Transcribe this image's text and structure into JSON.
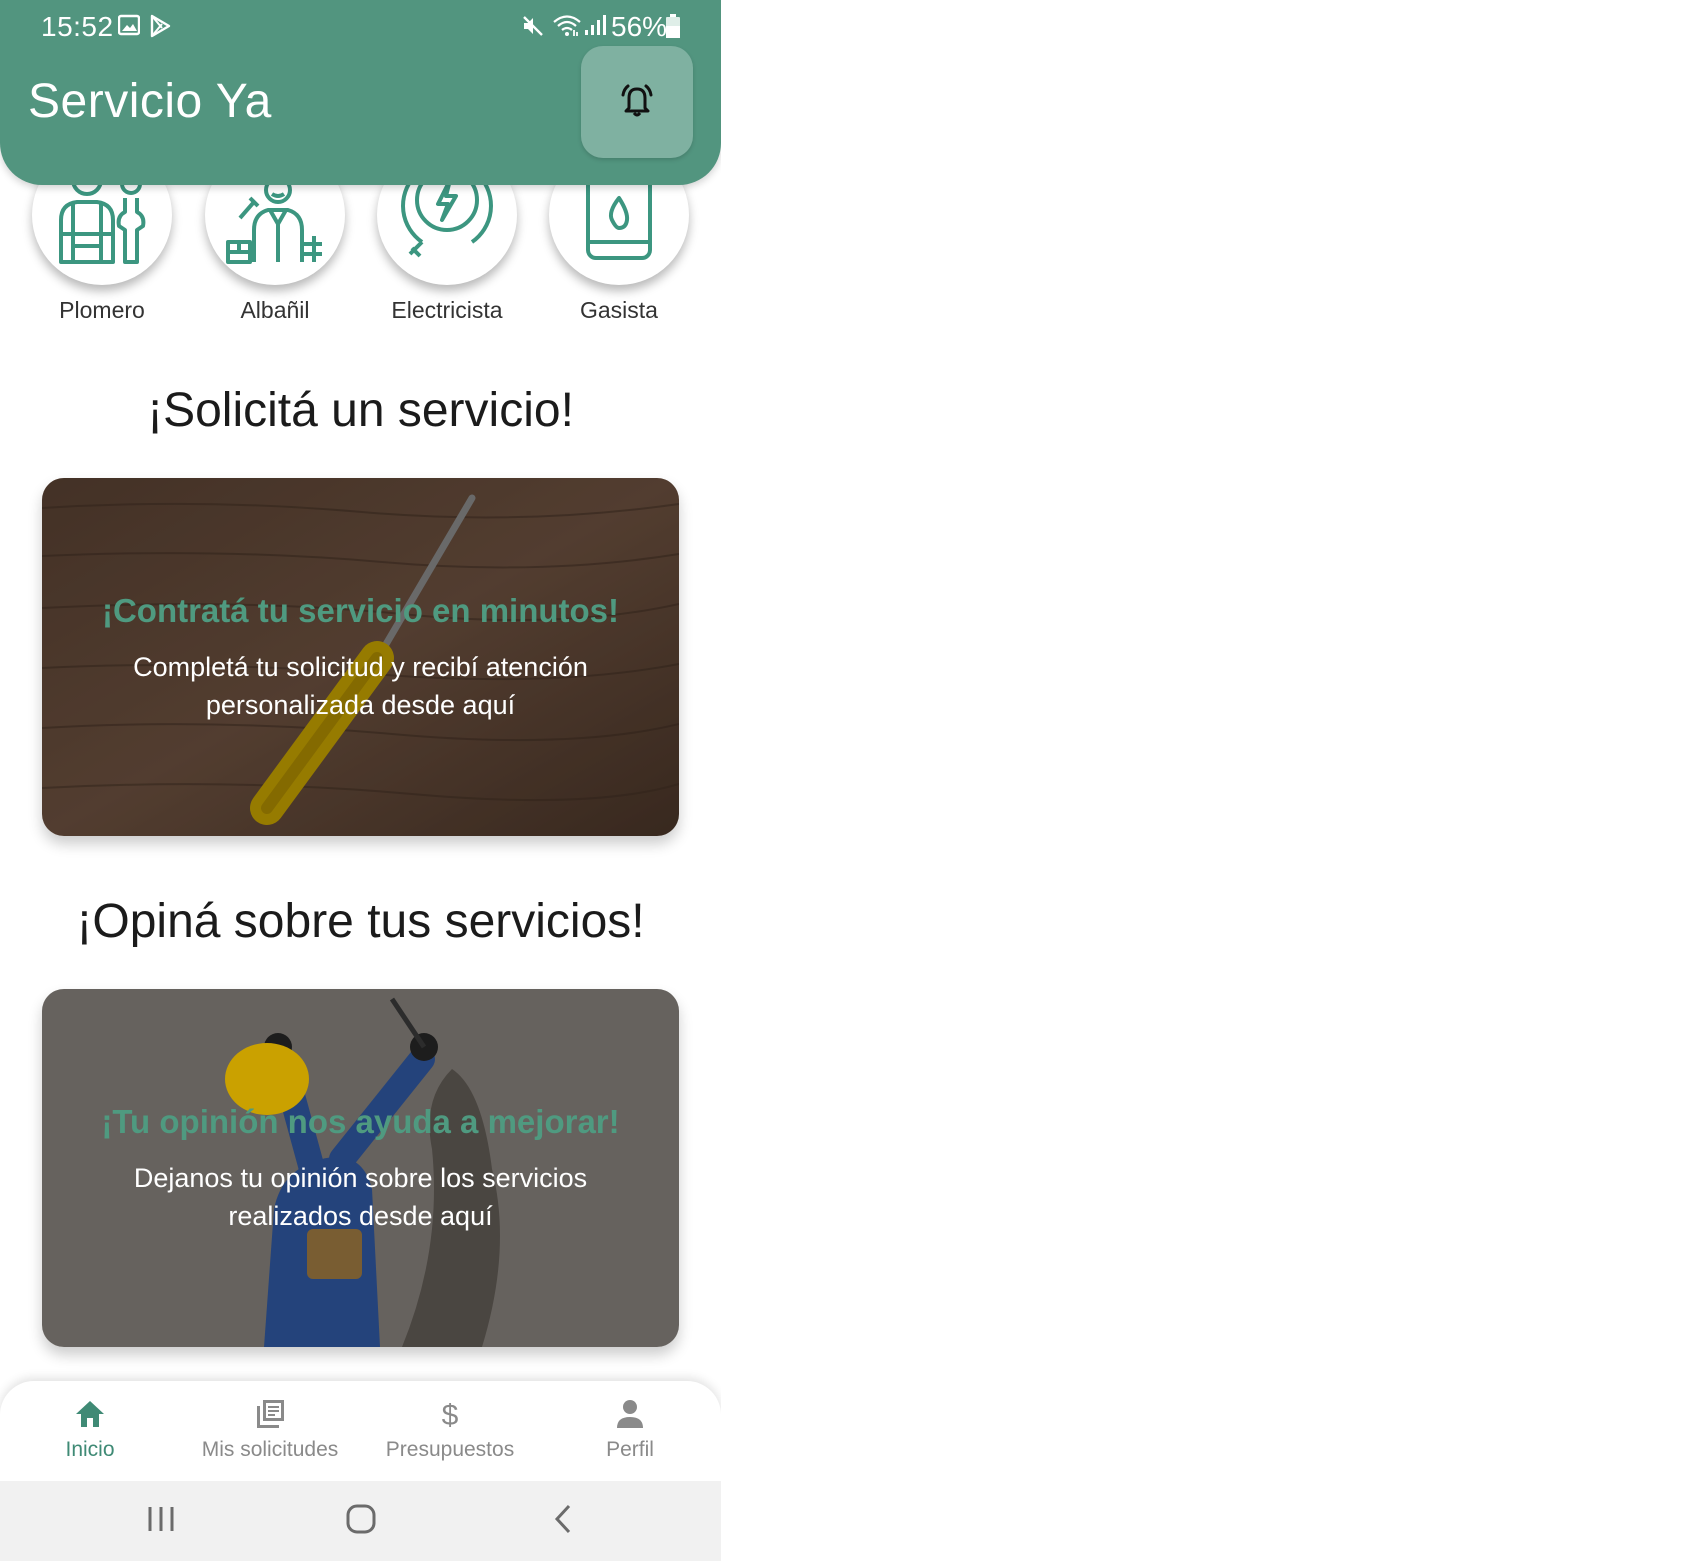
{
  "status_bar": {
    "time": "15:52",
    "battery": "56%",
    "icons": [
      "image-icon",
      "play-store-icon",
      "mute-icon",
      "wifi-icon",
      "signal-icon",
      "battery-icon"
    ]
  },
  "header": {
    "title": "Servicio Ya",
    "bell_icon": "bell-alert-icon",
    "color": "#52957f"
  },
  "categories": [
    {
      "label": "Plomero",
      "icon": "plumber-icon"
    },
    {
      "label": "Albañil",
      "icon": "mason-icon"
    },
    {
      "label": "Electricista",
      "icon": "electric-plug-icon"
    },
    {
      "label": "Gasista",
      "icon": "gas-heater-icon"
    }
  ],
  "sections": {
    "request_title": "¡Solicitá un servicio!",
    "review_title": "¡Opiná sobre tus servicios!"
  },
  "cards": {
    "request": {
      "headline": "¡Contratá tu servicio en minutos!",
      "line1": "Completá tu solicitud y recibí atención",
      "line2": "personalizada desde aquí"
    },
    "review": {
      "headline": "¡Tu opinión nos ayuda a mejorar!",
      "line1": "Dejanos tu opinión sobre los servicios",
      "line2": "realizados desde aquí"
    }
  },
  "bottom_nav": {
    "items": [
      {
        "label": "Inicio",
        "icon": "home-icon",
        "active": true
      },
      {
        "label": "Mis solicitudes",
        "icon": "library-icon",
        "active": false
      },
      {
        "label": "Presupuestos",
        "icon": "dollar-icon",
        "active": false
      },
      {
        "label": "Perfil",
        "icon": "person-icon",
        "active": false
      }
    ],
    "active_color": "#3f8a75"
  },
  "system_nav": [
    "recent-apps-icon",
    "home-circle-icon",
    "back-icon"
  ],
  "colors": {
    "accent": "#52957f",
    "headline_green": "#4f9a80"
  }
}
